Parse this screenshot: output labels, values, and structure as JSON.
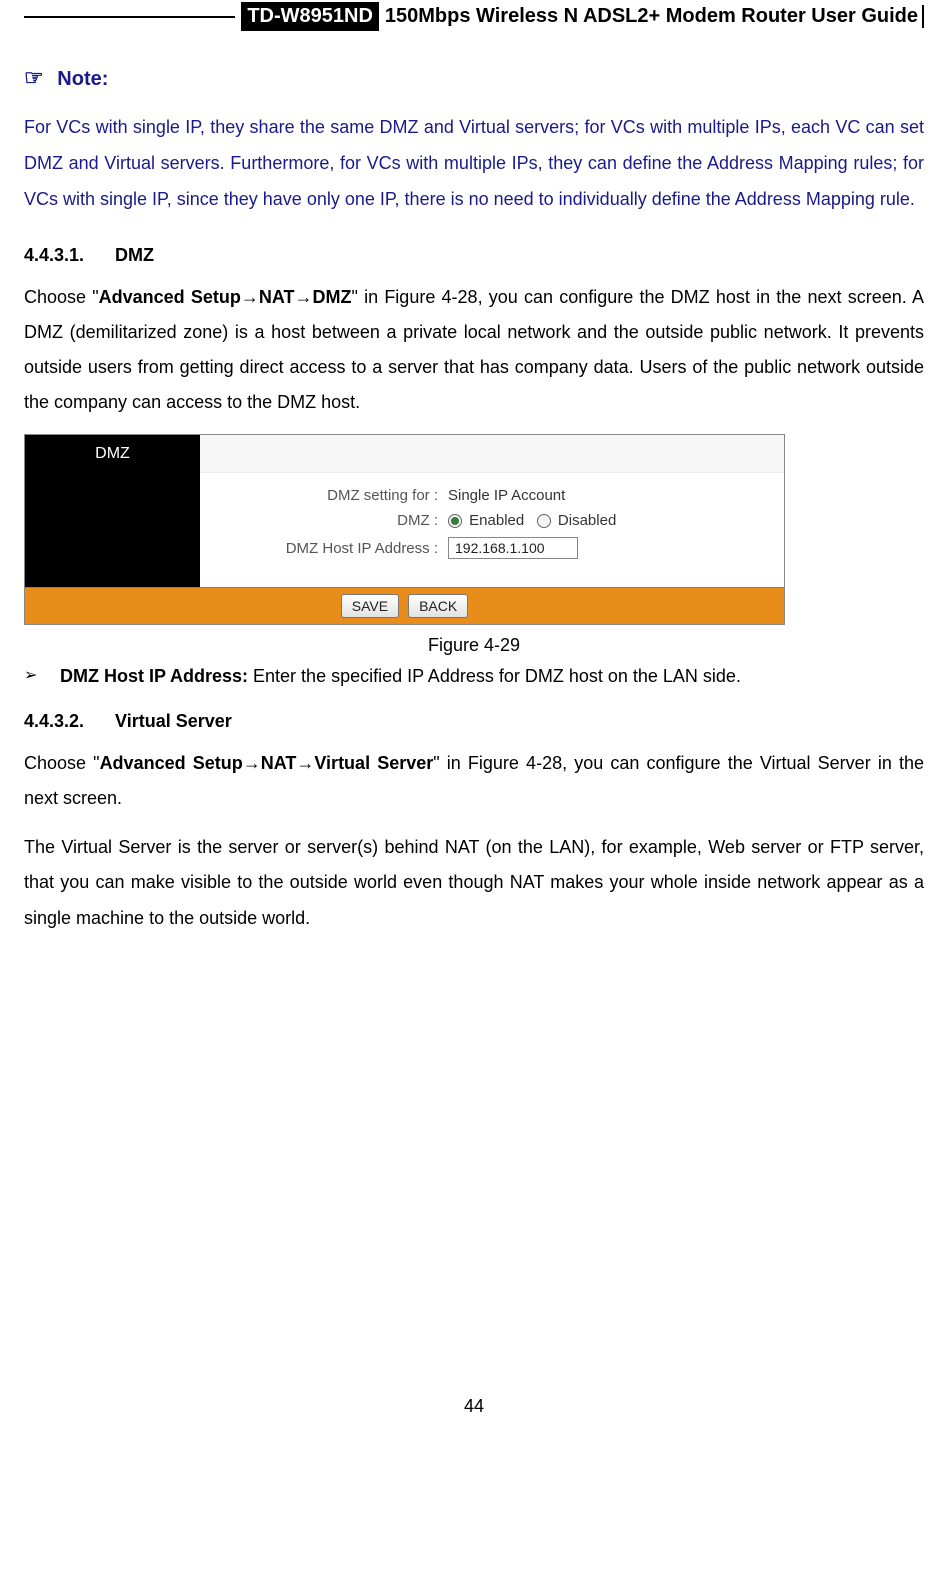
{
  "header": {
    "model": "TD-W8951ND",
    "title": "150Mbps Wireless N ADSL2+ Modem Router User Guide"
  },
  "note": {
    "icon": "☞",
    "label": "Note:",
    "body": "For VCs with single IP, they share the same DMZ and Virtual servers; for VCs with multiple IPs, each VC can set DMZ and Virtual servers. Furthermore, for VCs with multiple IPs, they can define the Address Mapping rules; for VCs with single IP, since they have only one IP, there is no need to individually define the Address Mapping rule."
  },
  "section1": {
    "num": "4.4.3.1.",
    "title": "DMZ",
    "para_pre": "Choose \"",
    "para_bold": "Advanced Setup→NAT→DMZ",
    "para_post": "\" in Figure 4-28, you can configure the DMZ host in the next screen. A DMZ (demilitarized zone) is a host between a private local network and the outside public network. It prevents outside users from getting direct access to a server that has company data. Users of the public network outside the company can access to the DMZ host."
  },
  "figure": {
    "tab": "DMZ",
    "row1_label": "DMZ setting for :",
    "row1_value": "Single IP Account",
    "row2_label": "DMZ :",
    "row2_opt1": "Enabled",
    "row2_opt2": "Disabled",
    "row3_label": "DMZ Host IP Address :",
    "row3_value": "192.168.1.100",
    "btn_save": "SAVE",
    "btn_back": "BACK",
    "caption": "Figure 4-29"
  },
  "bullet": {
    "arrow": "➢",
    "bold": "DMZ Host IP Address:",
    "rest": " Enter the specified IP Address for DMZ host on the LAN side."
  },
  "section2": {
    "num": "4.4.3.2.",
    "title": "Virtual Server",
    "para1_pre": "Choose \"",
    "para1_bold": "Advanced Setup→NAT→Virtual Server",
    "para1_post": "\" in Figure 4-28, you can configure the Virtual Server in the next screen.",
    "para2": "The Virtual Server is the server or server(s) behind NAT (on the LAN), for example, Web server or FTP server, that you can make visible to the outside world even though NAT makes your whole inside network appear as a single machine to the outside world."
  },
  "page_number": "44"
}
